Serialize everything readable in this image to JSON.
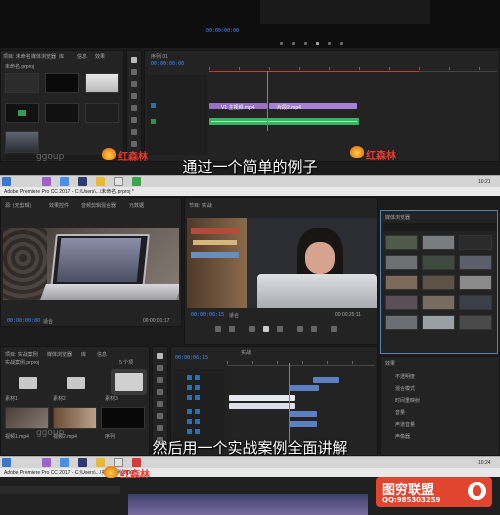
{
  "top": {
    "top_timecode": "00:00:00:00",
    "project_tabs": [
      "项目: 未命名",
      "媒体浏览器",
      "库",
      "信息",
      "效果"
    ],
    "project_label": "未命名.prproj",
    "seq_tab": "序列 01",
    "seq_timecode": "00:00:00:00",
    "clip_labels": [
      "V1 主视频.mp4",
      "片段2.mp4"
    ],
    "watermark_brand": "红森林",
    "watermark_corner": "ggoup",
    "subtitle": "通过一个简单的例子"
  },
  "taskbar1": {
    "app_title": "Adobe Premiere Pro CC 2017 - C:\\Users\\...\\未命名.prproj *",
    "time": "10:21"
  },
  "bottom": {
    "source_tabs": [
      "源: (无剪辑)",
      "效果控件",
      "音频剪辑混合器",
      "元数据"
    ],
    "program_tab": "节目: 实战",
    "source_tc": "00:00:00:00",
    "source_fit": "适合",
    "source_dur": "00:00:01:17",
    "program_tc": "00:00:06:15",
    "program_fit": "适合",
    "program_dur": "00:00:25:11",
    "project_tabs": [
      "项目: 实战案例",
      "媒体浏览器",
      "库",
      "信息"
    ],
    "project_path": "实战案例.prproj",
    "item_count": "5 个项",
    "bin_labels": [
      "素材1",
      "素材2",
      "素材3"
    ],
    "media_labels": [
      "视频1.mp4",
      "视频2.mp4",
      "序列"
    ],
    "timeline_tab": "实战",
    "timeline_tc": "00:00:06:15",
    "effects_title": "效果",
    "effects_panel_title": "媒体浏览器",
    "effect_controls": [
      "不透明度",
      "混合模式",
      "时间重映射",
      "音量",
      "声道音量",
      "声像器"
    ],
    "subtitle": "然后用一个实战案例全面讲解",
    "watermark_brand": "红森林",
    "watermark_corner": "ggoup",
    "promo_name": "图穷联盟",
    "promo_qq": "QQ:985303259"
  },
  "taskbar2": {
    "app_title": "Adobe Premiere Pro CC 2017 - C:\\Users\\...\\实战案例.prproj",
    "time": "10:24"
  }
}
